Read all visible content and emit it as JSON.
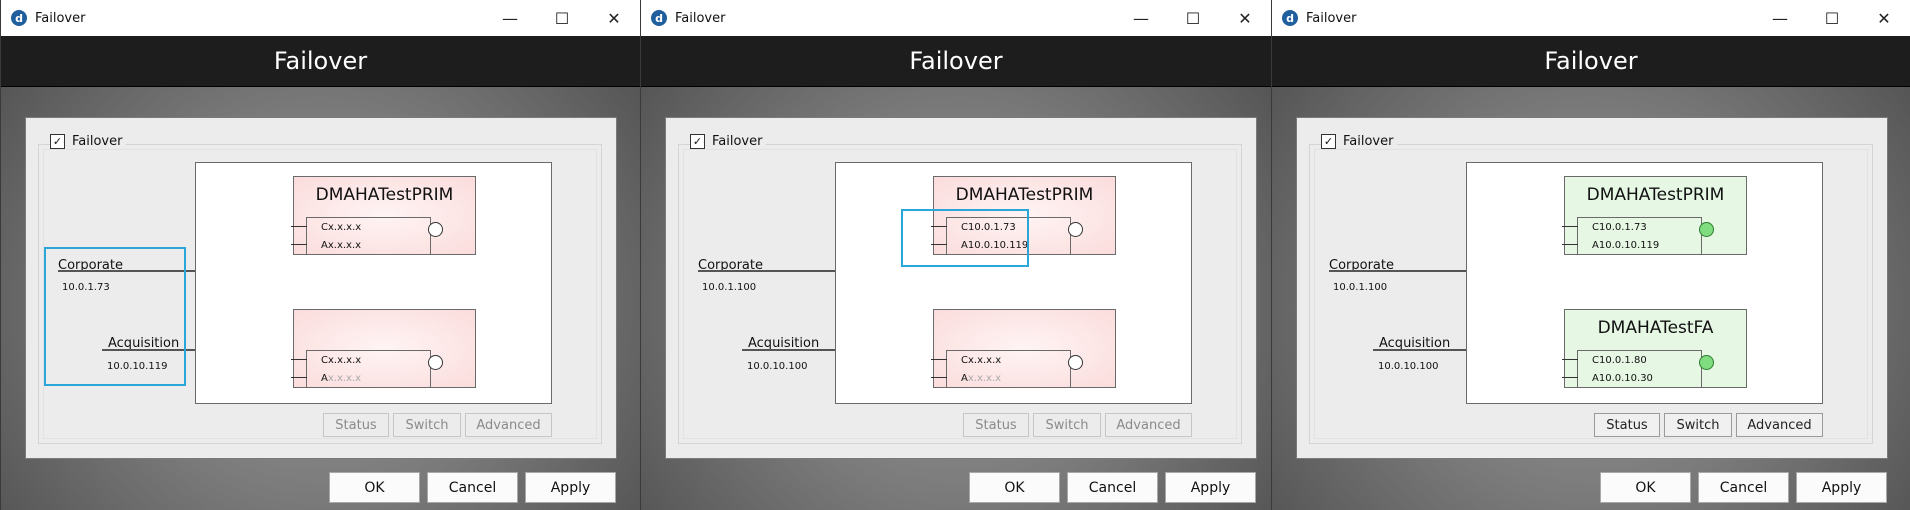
{
  "windows": [
    {
      "window_title": "Failover",
      "header_title": "Failover",
      "failover_checkbox": {
        "label": "Failover",
        "checked": true
      },
      "networks": [
        {
          "name": "Corporate",
          "ip": "10.0.1.73"
        },
        {
          "name": "Acquisition",
          "ip": "10.0.10.119"
        }
      ],
      "servers": [
        {
          "name": "DMAHATestPRIM",
          "state": "red",
          "nic_c": "Cx.x.x.x",
          "nic_a": "Ax.x.x.x",
          "nic_a_gray": "",
          "online": false
        },
        {
          "name": "",
          "state": "red",
          "nic_c": "Cx.x.x.x",
          "nic_a": "A",
          "nic_a_gray": "x.x.x.x",
          "online": false
        }
      ],
      "buttons": {
        "status": "Status",
        "switch": "Switch",
        "advanced": "Advanced",
        "enabled": false
      },
      "footer": {
        "ok": "OK",
        "cancel": "Cancel",
        "apply": "Apply"
      }
    },
    {
      "window_title": "Failover",
      "header_title": "Failover",
      "failover_checkbox": {
        "label": "Failover",
        "checked": true
      },
      "networks": [
        {
          "name": "Corporate",
          "ip": "10.0.1.100"
        },
        {
          "name": "Acquisition",
          "ip": "10.0.10.100"
        }
      ],
      "servers": [
        {
          "name": "DMAHATestPRIM",
          "state": "red",
          "nic_c": "C10.0.1.73",
          "nic_a": "A10.0.10.119",
          "nic_a_gray": "",
          "online": false
        },
        {
          "name": "",
          "state": "red",
          "nic_c": "Cx.x.x.x",
          "nic_a": "A",
          "nic_a_gray": "x.x.x.x",
          "online": false
        }
      ],
      "buttons": {
        "status": "Status",
        "switch": "Switch",
        "advanced": "Advanced",
        "enabled": false
      },
      "footer": {
        "ok": "OK",
        "cancel": "Cancel",
        "apply": "Apply"
      }
    },
    {
      "window_title": "Failover",
      "header_title": "Failover",
      "failover_checkbox": {
        "label": "Failover",
        "checked": true
      },
      "networks": [
        {
          "name": "Corporate",
          "ip": "10.0.1.100"
        },
        {
          "name": "Acquisition",
          "ip": "10.0.10.100"
        }
      ],
      "servers": [
        {
          "name": "DMAHATestPRIM",
          "state": "green",
          "nic_c": "C10.0.1.73",
          "nic_a": "A10.0.10.119",
          "nic_a_gray": "",
          "online": true
        },
        {
          "name": "DMAHATestFA",
          "state": "green",
          "nic_c": "C10.0.1.80",
          "nic_a": "A10.0.10.30",
          "nic_a_gray": "",
          "online": true
        }
      ],
      "buttons": {
        "status": "Status",
        "switch": "Switch",
        "advanced": "Advanced",
        "enabled": true
      },
      "footer": {
        "ok": "OK",
        "cancel": "Cancel",
        "apply": "Apply"
      }
    }
  ],
  "colors": {
    "header_bg": "#1d1d1d",
    "highlight": "#2ba6d9",
    "server_red": "#fbdcdc",
    "server_green": "#e6f7e4",
    "status_on": "#7fdc7f"
  },
  "icons": {
    "app": "d-logo-icon",
    "minimize": "minimize-icon",
    "maximize": "maximize-icon",
    "close": "close-icon",
    "check": "checkmark-icon"
  }
}
